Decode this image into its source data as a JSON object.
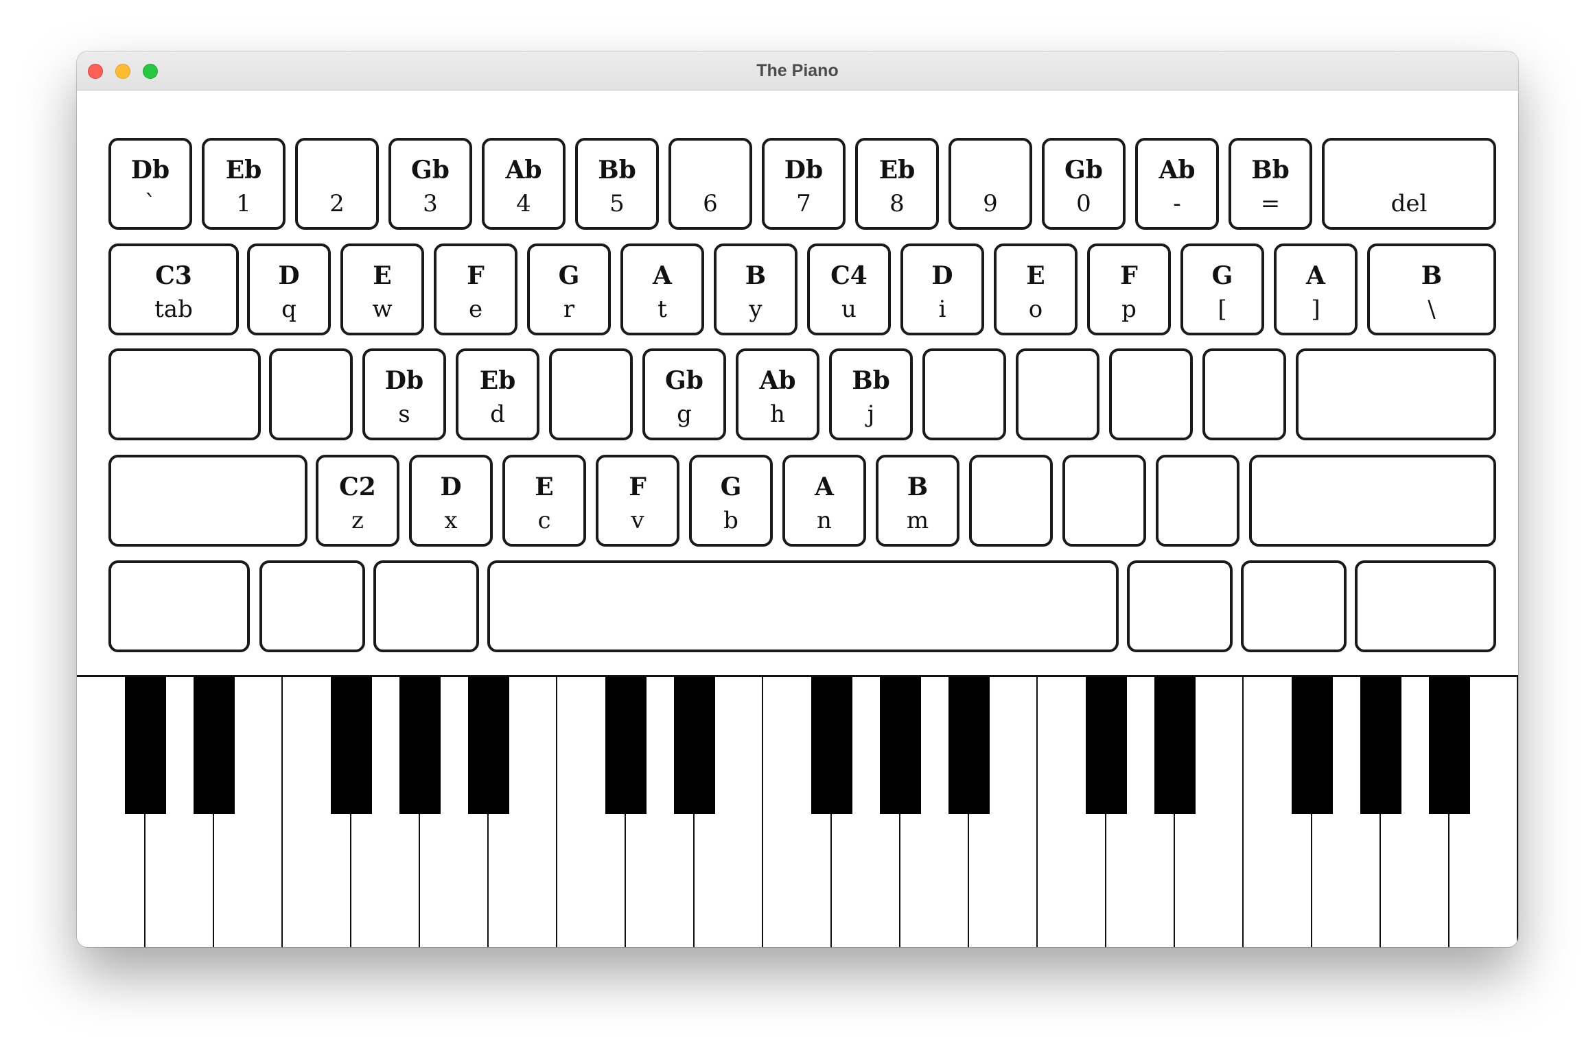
{
  "window": {
    "title": "The Piano"
  },
  "keyboard": {
    "rows": [
      [
        {
          "note": "Db",
          "char": "`"
        },
        {
          "note": "Eb",
          "char": "1"
        },
        {
          "note": "",
          "char": "2"
        },
        {
          "note": "Gb",
          "char": "3"
        },
        {
          "note": "Ab",
          "char": "4"
        },
        {
          "note": "Bb",
          "char": "5"
        },
        {
          "note": "",
          "char": "6"
        },
        {
          "note": "Db",
          "char": "7"
        },
        {
          "note": "Eb",
          "char": "8"
        },
        {
          "note": "",
          "char": "9"
        },
        {
          "note": "Gb",
          "char": "0"
        },
        {
          "note": "Ab",
          "char": "-"
        },
        {
          "note": "Bb",
          "char": "="
        },
        {
          "note": "",
          "char": "del"
        }
      ],
      [
        {
          "note": "C3",
          "char": "tab"
        },
        {
          "note": "D",
          "char": "q"
        },
        {
          "note": "E",
          "char": "w"
        },
        {
          "note": "F",
          "char": "e"
        },
        {
          "note": "G",
          "char": "r"
        },
        {
          "note": "A",
          "char": "t"
        },
        {
          "note": "B",
          "char": "y"
        },
        {
          "note": "C4",
          "char": "u"
        },
        {
          "note": "D",
          "char": "i"
        },
        {
          "note": "E",
          "char": "o"
        },
        {
          "note": "F",
          "char": "p"
        },
        {
          "note": "G",
          "char": "["
        },
        {
          "note": "A",
          "char": "]"
        },
        {
          "note": "B",
          "char": "\\"
        }
      ],
      [
        {
          "note": "",
          "char": ""
        },
        {
          "note": "",
          "char": ""
        },
        {
          "note": "Db",
          "char": "s"
        },
        {
          "note": "Eb",
          "char": "d"
        },
        {
          "note": "",
          "char": ""
        },
        {
          "note": "Gb",
          "char": "g"
        },
        {
          "note": "Ab",
          "char": "h"
        },
        {
          "note": "Bb",
          "char": "j"
        },
        {
          "note": "",
          "char": ""
        },
        {
          "note": "",
          "char": ""
        },
        {
          "note": "",
          "char": ""
        },
        {
          "note": "",
          "char": ""
        },
        {
          "note": "",
          "char": ""
        }
      ],
      [
        {
          "note": "",
          "char": ""
        },
        {
          "note": "C2",
          "char": "z"
        },
        {
          "note": "D",
          "char": "x"
        },
        {
          "note": "E",
          "char": "c"
        },
        {
          "note": "F",
          "char": "v"
        },
        {
          "note": "G",
          "char": "b"
        },
        {
          "note": "A",
          "char": "n"
        },
        {
          "note": "B",
          "char": "m"
        },
        {
          "note": "",
          "char": ""
        },
        {
          "note": "",
          "char": ""
        },
        {
          "note": "",
          "char": ""
        },
        {
          "note": "",
          "char": ""
        }
      ],
      [
        {
          "note": "",
          "char": ""
        },
        {
          "note": "",
          "char": ""
        },
        {
          "note": "",
          "char": ""
        },
        {
          "note": "",
          "char": ""
        },
        {
          "note": "",
          "char": ""
        },
        {
          "note": "",
          "char": ""
        },
        {
          "note": "",
          "char": ""
        }
      ]
    ]
  },
  "piano": {
    "white_key_count": 21,
    "black_key_after_white": [
      0,
      1,
      3,
      4,
      5,
      7,
      8,
      10,
      11,
      12,
      14,
      15,
      17,
      18,
      19
    ]
  }
}
